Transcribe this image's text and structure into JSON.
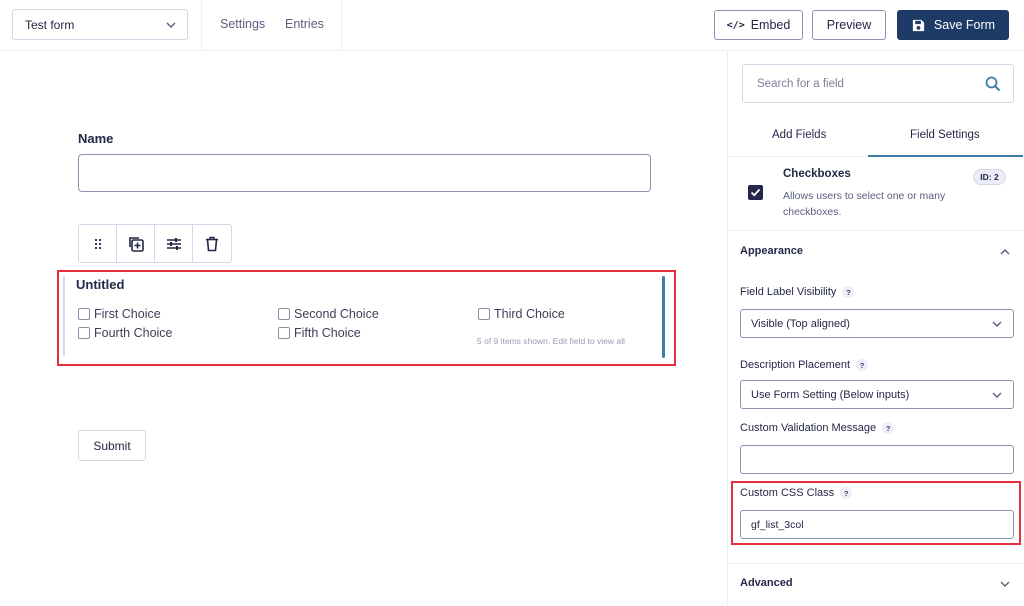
{
  "topbar": {
    "form_name": "Test form",
    "nav": [
      "Settings",
      "Entries"
    ],
    "embed_label": "Embed",
    "embed_icon": "</>",
    "preview_label": "Preview",
    "save_label": "Save Form"
  },
  "canvas": {
    "name_label": "Name",
    "field_title": "Untitled",
    "choices": [
      "First Choice",
      "Second Choice",
      "Third Choice",
      "Fourth Choice",
      "Fifth Choice"
    ],
    "items_note": "5 of 9 items shown. Edit field to view all",
    "submit_label": "Submit"
  },
  "sidebar": {
    "search_placeholder": "Search for a field",
    "tabs": [
      "Add Fields",
      "Field Settings"
    ],
    "field": {
      "title": "Checkboxes",
      "desc": "Allows users to select one or many checkboxes.",
      "id_badge": "ID: 2"
    },
    "appearance_title": "Appearance",
    "label_visibility_label": "Field Label Visibility",
    "label_visibility_value": "Visible (Top aligned)",
    "desc_placement_label": "Description Placement",
    "desc_placement_value": "Use Form Setting (Below inputs)",
    "validation_label": "Custom Validation Message",
    "validation_value": "",
    "css_class_label": "Custom CSS Class",
    "css_class_value": "gf_list_3col",
    "advanced_title": "Advanced",
    "help_mark": "?"
  },
  "colors": {
    "primary_dark": "#1e3a67",
    "highlight_red": "#e5303a",
    "accent_blue": "#3e7da6"
  }
}
